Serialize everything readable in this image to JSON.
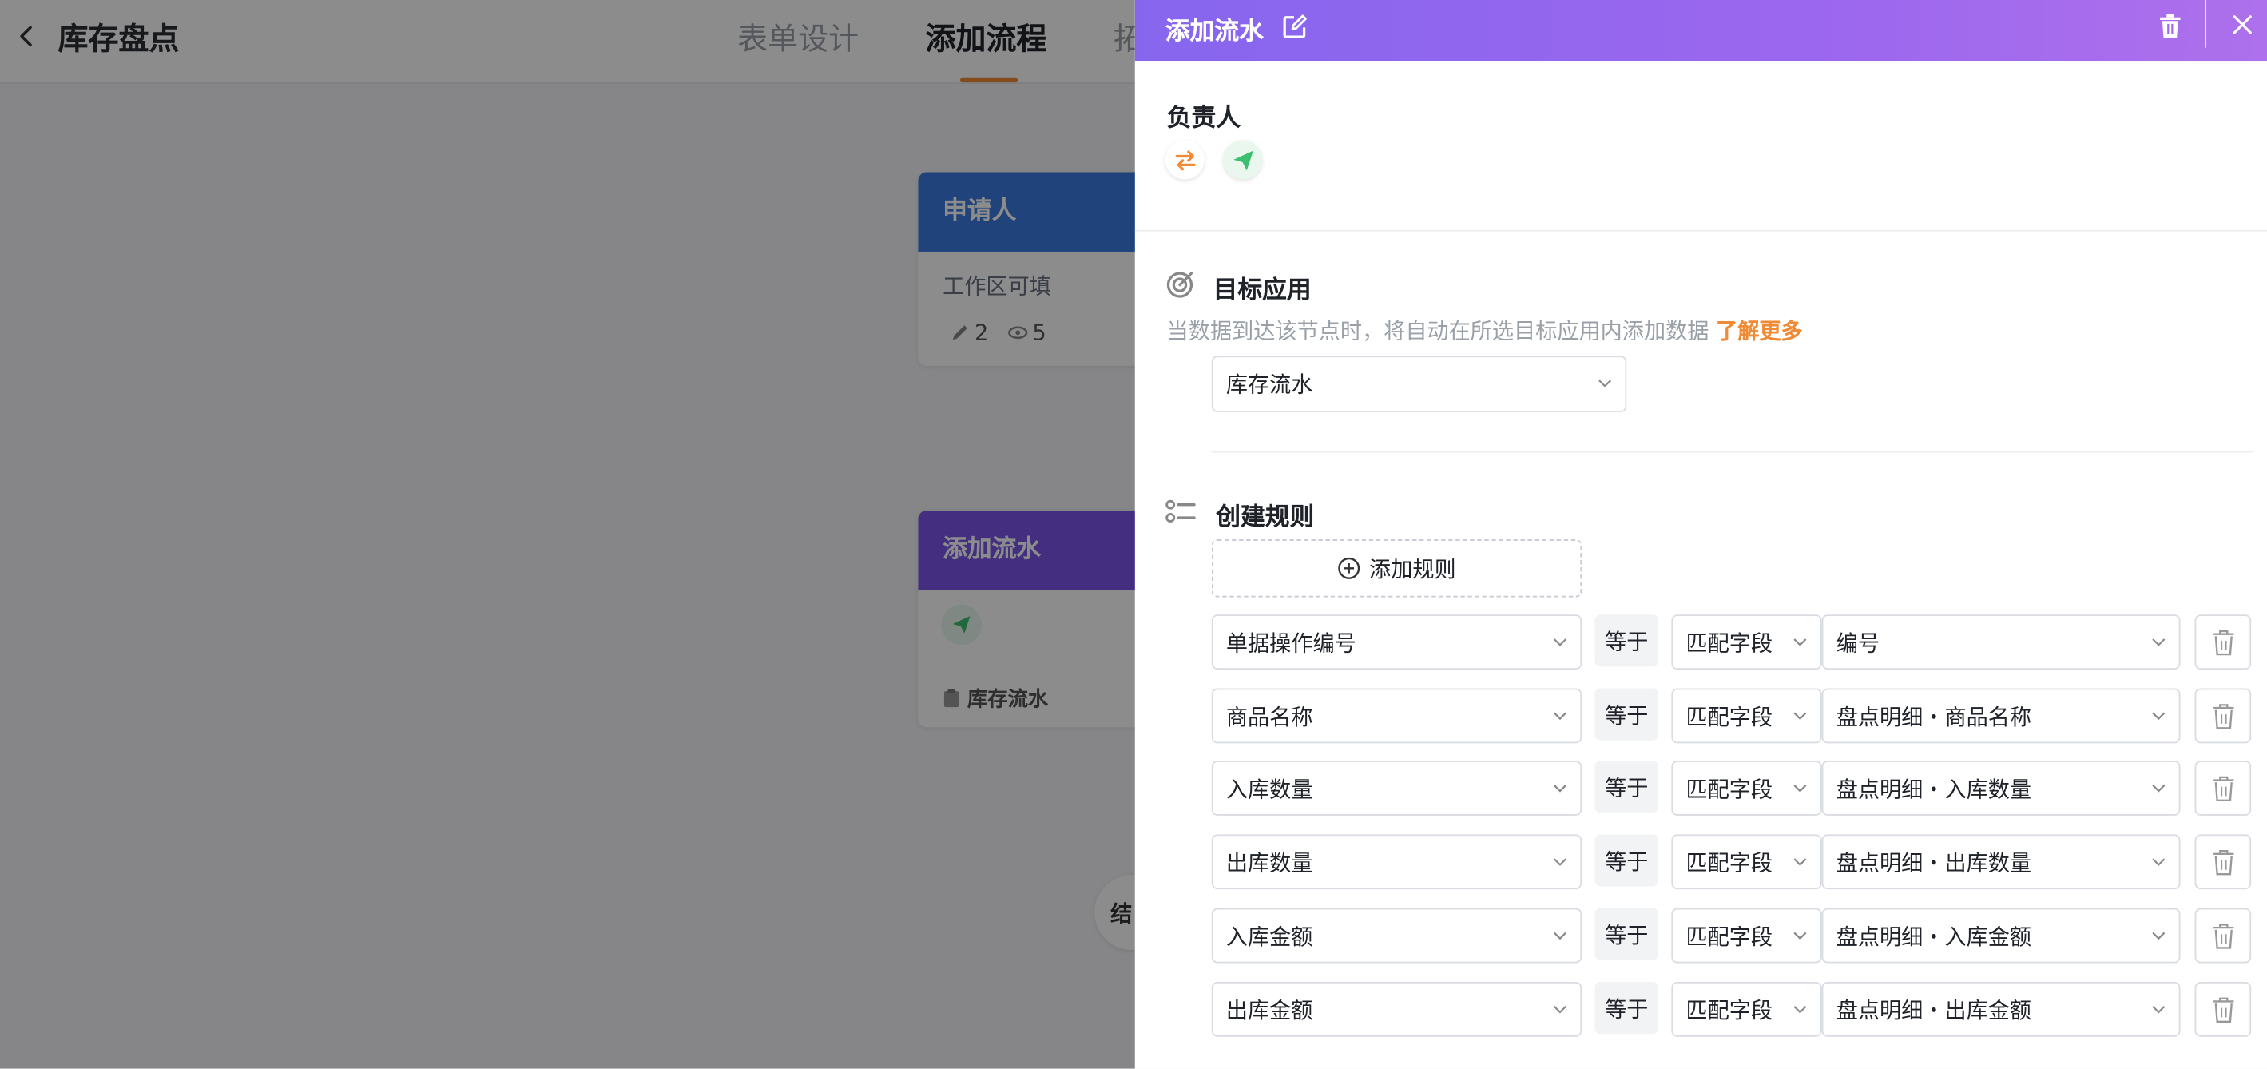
{
  "header": {
    "app_title": "库存盘点",
    "tabs": [
      {
        "label": "表单设计",
        "active": false
      },
      {
        "label": "添加流程",
        "active": true
      },
      {
        "label": "拓",
        "active": false
      }
    ]
  },
  "flow": {
    "applicant_node": {
      "title": "申请人",
      "subtitle": "工作区可填",
      "edit_count": "2",
      "view_count": "5"
    },
    "add_flow_node": {
      "title": "添加流水",
      "target": "库存流水"
    },
    "end_node_label": "结"
  },
  "drawer": {
    "title": "添加流水",
    "owner_label": "负责人",
    "target_section": {
      "label": "目标应用",
      "hint": "当数据到达该节点时，将自动在所选目标应用内添加数据",
      "learn_more": "了解更多",
      "selected_app": "库存流水"
    },
    "rules_section": {
      "label": "创建规则",
      "add_rule": "添加规则",
      "rules": [
        {
          "field": "单据操作编号",
          "op": "等于",
          "mode": "匹配字段",
          "value": "编号"
        },
        {
          "field": "商品名称",
          "op": "等于",
          "mode": "匹配字段",
          "value": "盘点明细・商品名称"
        },
        {
          "field": "入库数量",
          "op": "等于",
          "mode": "匹配字段",
          "value": "盘点明细・入库数量"
        },
        {
          "field": "出库数量",
          "op": "等于",
          "mode": "匹配字段",
          "value": "盘点明细・出库数量"
        },
        {
          "field": "入库金额",
          "op": "等于",
          "mode": "匹配字段",
          "value": "盘点明细・入库金额"
        },
        {
          "field": "出库金额",
          "op": "等于",
          "mode": "匹配字段",
          "value": "盘点明细・出库金额"
        }
      ]
    }
  },
  "colors": {
    "header_gradient_start": "#8766ee",
    "header_gradient_end": "#ae70ec",
    "accent_orange": "#f08a34",
    "applicant_blue": "#3d7be0",
    "add_flow_purple": "#7a55e8",
    "send_green": "#3cbf6e"
  },
  "icons": {
    "back": "chevron-left-icon",
    "edit": "edit-icon",
    "delete": "trash-icon",
    "close": "close-icon",
    "swap": "swap-icon",
    "send": "send-icon",
    "target": "target-icon",
    "list": "list-icon",
    "add": "plus-circle-icon",
    "dropdown": "chevron-down-icon"
  }
}
